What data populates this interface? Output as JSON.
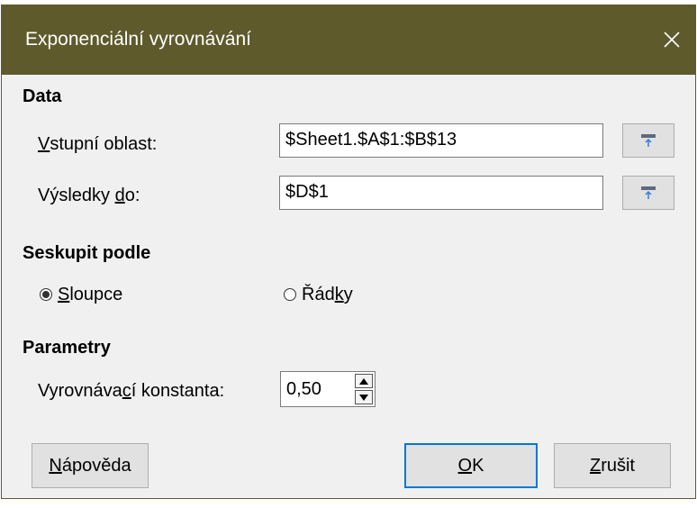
{
  "window": {
    "title": "Exponenciální vyrovnávání",
    "close_icon": "close-icon"
  },
  "data_section": {
    "title": "Data",
    "input_range": {
      "label_prefix": "V",
      "label_rest": "stupní oblast:",
      "value": "$Sheet1.$A$1:$B$13"
    },
    "results_to": {
      "label_pre": "Výsledky ",
      "label_ul": "d",
      "label_post": "o:",
      "value": "$D$1"
    },
    "shrink_icon": "shrink-selection-icon"
  },
  "grouping": {
    "title": "Seskupit podle",
    "columns": {
      "label_ul": "S",
      "label_rest": "loupce",
      "selected": true
    },
    "rows": {
      "label_pre": "Řád",
      "label_ul": "k",
      "label_post": "y",
      "selected": false
    }
  },
  "parameters": {
    "title": "Parametry",
    "smoothing": {
      "label_pre": "Vyrovnáva",
      "label_ul": "c",
      "label_post": "í konstanta:",
      "value": "0,50"
    }
  },
  "buttons": {
    "help": {
      "label_ul": "N",
      "label_rest": "ápověda"
    },
    "ok": {
      "label_ul": "O",
      "label_rest": "K"
    },
    "cancel": {
      "label_ul": "Z",
      "label_rest": "rušit"
    }
  }
}
